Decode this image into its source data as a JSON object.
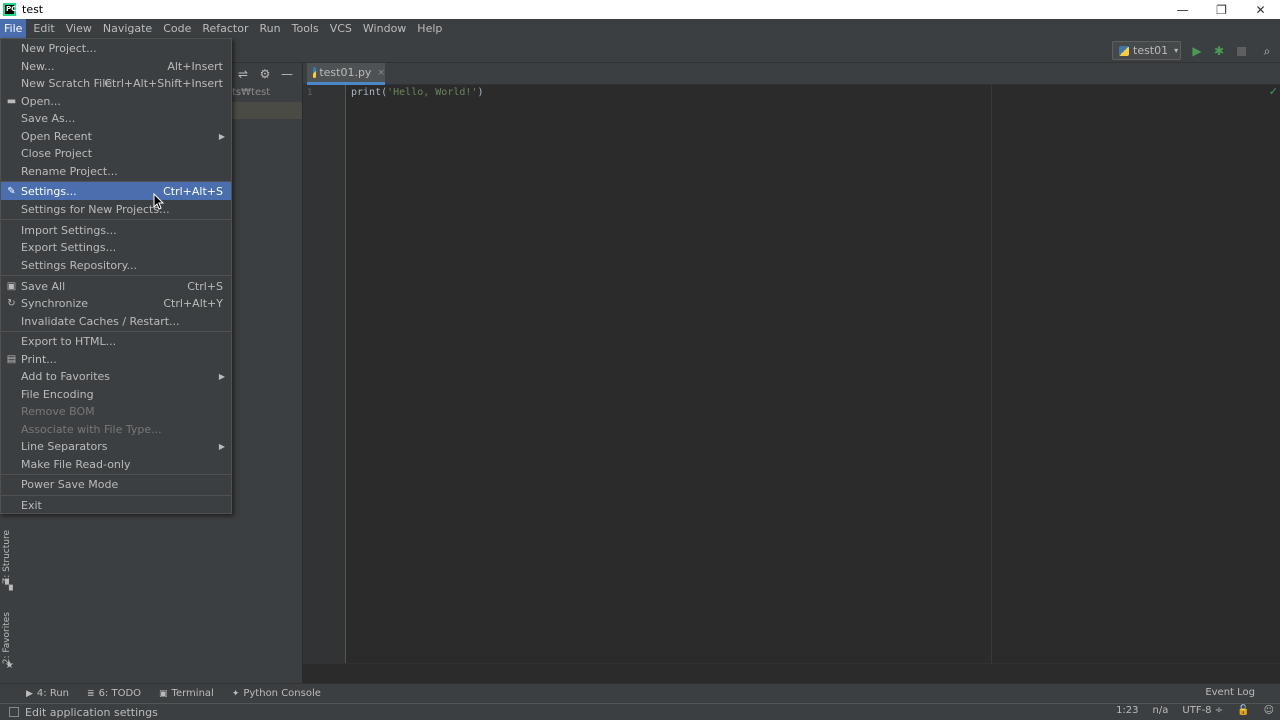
{
  "window": {
    "title": "test",
    "minimize": "—",
    "maximize": "❐",
    "close": "✕"
  },
  "menubar": [
    "File",
    "Edit",
    "View",
    "Navigate",
    "Code",
    "Refactor",
    "Run",
    "Tools",
    "VCS",
    "Window",
    "Help"
  ],
  "toolbar": {
    "run_config": "test01",
    "caret": "▾",
    "play": "▶",
    "debug": "✱",
    "search": "⌕"
  },
  "project": {
    "path": "ts₩test",
    "head_icons": [
      "⇌",
      "⚙",
      "—"
    ]
  },
  "editor": {
    "tab_label": "test01.py",
    "tab_close": "×",
    "line_number": "1",
    "code_fn": "print(",
    "code_str": "'Hello, World!'",
    "code_end": ")",
    "check": "✓"
  },
  "left_tabs": {
    "structure": "Z: Structure",
    "favorites": "2: Favorites"
  },
  "bottom_tabs": [
    {
      "icon": "▶",
      "label": "4: Run"
    },
    {
      "icon": "≣",
      "label": "6: TODO"
    },
    {
      "icon": "▣",
      "label": "Terminal"
    },
    {
      "icon": "✦",
      "label": "Python Console"
    }
  ],
  "event_log": "Event Log",
  "status": {
    "message": "Edit application settings",
    "position": "1:23",
    "na": "n/a",
    "encoding": "UTF-8 ÷",
    "lock": "🔓",
    "inspector": "☺"
  },
  "file_menu": {
    "new_project": "New Project...",
    "new": {
      "label": "New...",
      "shortcut": "Alt+Insert"
    },
    "new_scratch": {
      "label": "New Scratch File",
      "shortcut": "Ctrl+Alt+Shift+Insert"
    },
    "open": "Open...",
    "save_as": "Save As...",
    "open_recent": "Open Recent",
    "close_project": "Close Project",
    "rename_project": "Rename Project...",
    "settings": {
      "label": "Settings...",
      "shortcut": "Ctrl+Alt+S"
    },
    "settings_new": "Settings for New Projects...",
    "import_settings": "Import Settings...",
    "export_settings": "Export Settings...",
    "settings_repo": "Settings Repository...",
    "save_all": {
      "label": "Save All",
      "shortcut": "Ctrl+S"
    },
    "synchronize": {
      "label": "Synchronize",
      "shortcut": "Ctrl+Alt+Y"
    },
    "invalidate": "Invalidate Caches / Restart...",
    "export_html": "Export to HTML...",
    "print": "Print...",
    "add_favorites": "Add to Favorites",
    "file_encoding": "File Encoding",
    "remove_bom": "Remove BOM",
    "associate": "Associate with File Type...",
    "line_separators": "Line Separators",
    "make_readonly": "Make File Read-only",
    "power_save": "Power Save Mode",
    "exit": "Exit"
  }
}
